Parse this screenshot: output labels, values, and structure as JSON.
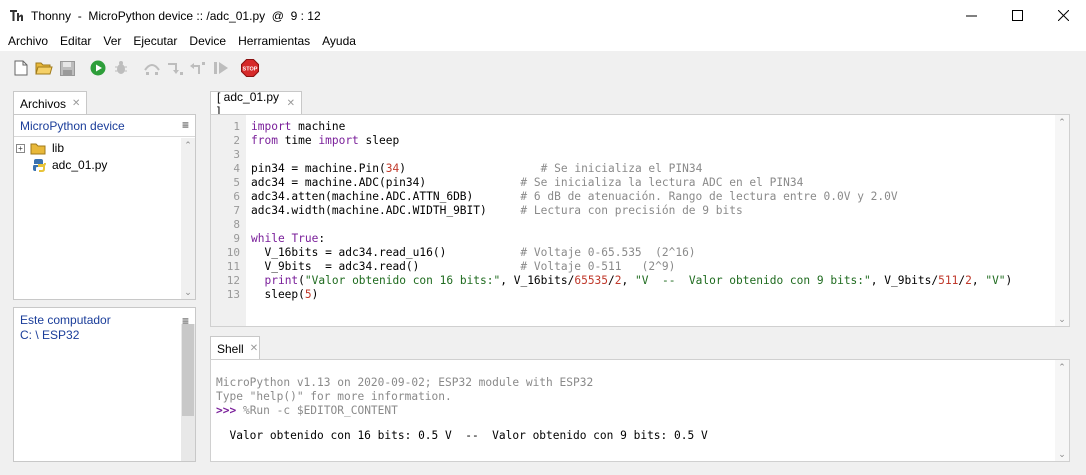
{
  "window": {
    "title": "Thonny  -  MicroPython device :: /adc_01.py  @  9 : 12"
  },
  "menu": [
    "Archivo",
    "Editar",
    "Ver",
    "Ejecutar",
    "Device",
    "Herramientas",
    "Ayuda"
  ],
  "toolbar": [
    "new-file",
    "open-file",
    "save-file",
    "run",
    "debug",
    "step-over",
    "step-into",
    "step-out",
    "resume",
    "stop"
  ],
  "files_panel": {
    "tab": "Archivos",
    "device_header": "MicroPython device",
    "menu_glyph": "≡",
    "items": [
      {
        "name": "lib",
        "expander": "+",
        "icon": "folder-icon"
      },
      {
        "name": "adc_01.py",
        "icon": "python-file-icon"
      }
    ],
    "computer_header": "Este computador",
    "computer_path": "C: \\ ESP32"
  },
  "editor": {
    "tab": "[ adc_01.py ]",
    "line_numbers": [
      "1",
      "2",
      "3",
      "4",
      "5",
      "6",
      "7",
      "8",
      "9",
      "10",
      "11",
      "12",
      "13"
    ],
    "lines": [
      [
        {
          "t": "import",
          "c": "kw"
        },
        {
          "t": " machine"
        }
      ],
      [
        {
          "t": "from",
          "c": "kw"
        },
        {
          "t": " time "
        },
        {
          "t": "import",
          "c": "kw"
        },
        {
          "t": " sleep"
        }
      ],
      [],
      [
        {
          "t": "pin34 = machine.Pin("
        },
        {
          "t": "34",
          "c": "num"
        },
        {
          "t": ")                    "
        },
        {
          "t": "# Se inicializa el PIN34",
          "c": "cm"
        }
      ],
      [
        {
          "t": "adc34 = machine.ADC(pin34)              "
        },
        {
          "t": "# Se inicializa la lectura ADC en el PIN34",
          "c": "cm"
        }
      ],
      [
        {
          "t": "adc34.atten(machine.ADC.ATTN_6DB)       "
        },
        {
          "t": "# 6 dB de atenuación. Rango de lectura entre 0.0V y 2.0V",
          "c": "cm"
        }
      ],
      [
        {
          "t": "adc34.width(machine.ADC.WIDTH_9BIT)     "
        },
        {
          "t": "# Lectura con precisión de 9 bits",
          "c": "cm"
        }
      ],
      [],
      [
        {
          "t": "while",
          "c": "kw"
        },
        {
          "t": " "
        },
        {
          "t": "True",
          "c": "kw"
        },
        {
          "t": ":"
        }
      ],
      [
        {
          "t": "  V_16bits = adc34.read_u16()           "
        },
        {
          "t": "# Voltaje 0-65.535  (2^16)",
          "c": "cm"
        }
      ],
      [
        {
          "t": "  V_9bits  = adc34.read()               "
        },
        {
          "t": "# Voltaje 0-511   (2^9)",
          "c": "cm"
        }
      ],
      [
        {
          "t": "  "
        },
        {
          "t": "print",
          "c": "kw"
        },
        {
          "t": "("
        },
        {
          "t": "\"Valor obtenido con 16 bits:\"",
          "c": "str"
        },
        {
          "t": ", V_16bits/"
        },
        {
          "t": "65535",
          "c": "num"
        },
        {
          "t": "/"
        },
        {
          "t": "2",
          "c": "num"
        },
        {
          "t": ", "
        },
        {
          "t": "\"V  --  Valor obtenido con 9 bits:\"",
          "c": "str"
        },
        {
          "t": ", V_9bits/"
        },
        {
          "t": "511",
          "c": "num"
        },
        {
          "t": "/"
        },
        {
          "t": "2",
          "c": "num"
        },
        {
          "t": ", "
        },
        {
          "t": "\"V\"",
          "c": "str"
        },
        {
          "t": ")"
        }
      ],
      [
        {
          "t": "  sleep("
        },
        {
          "t": "5",
          "c": "num"
        },
        {
          "t": ")"
        }
      ]
    ]
  },
  "shell": {
    "tab": "Shell",
    "banner": "MicroPython v1.13 on 2020-09-02; ESP32 module with ESP32",
    "help": "Type \"help()\" for more information.",
    "prompt": ">>>",
    "command": " %Run -c $EDITOR_CONTENT",
    "output": "  Valor obtenido con 16 bits: 0.5 V  --  Valor obtenido con 9 bits: 0.5 V"
  }
}
